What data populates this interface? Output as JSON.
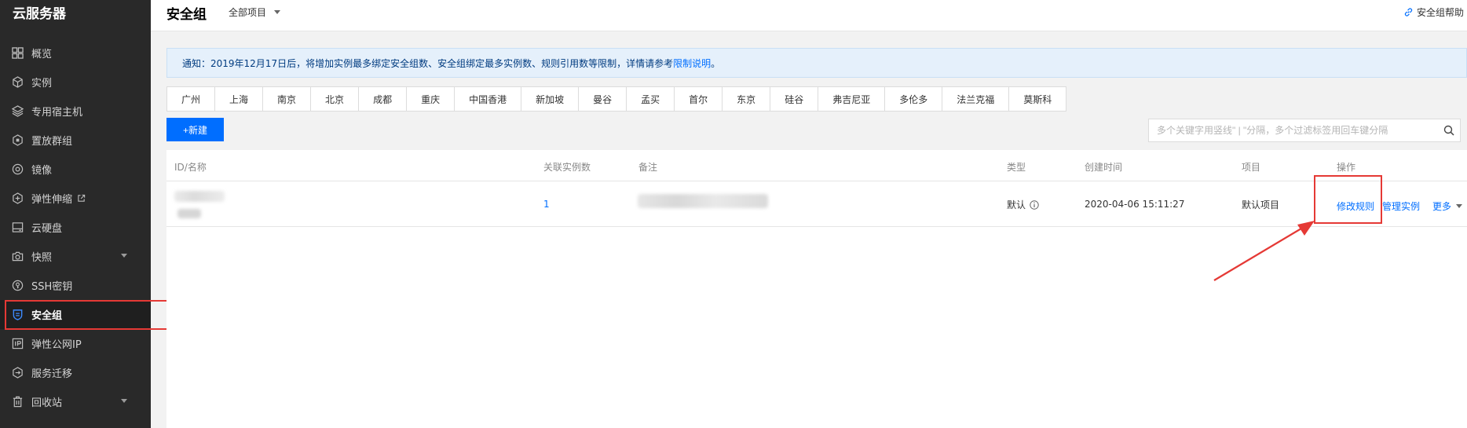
{
  "sidebar": {
    "title": "云服务器",
    "items": [
      {
        "label": "概览",
        "icon": "grid-icon"
      },
      {
        "label": "实例",
        "icon": "cube-icon"
      },
      {
        "label": "专用宿主机",
        "icon": "layers-icon"
      },
      {
        "label": "置放群组",
        "icon": "placement-icon"
      },
      {
        "label": "镜像",
        "icon": "disc-icon"
      },
      {
        "label": "弹性伸缩",
        "icon": "scaling-icon"
      },
      {
        "label": "云硬盘",
        "icon": "disk-icon"
      },
      {
        "label": "快照",
        "icon": "camera-icon"
      },
      {
        "label": "SSH密钥",
        "icon": "key-icon"
      },
      {
        "label": "安全组",
        "icon": "shield-icon"
      },
      {
        "label": "弹性公网IP",
        "icon": "ip-icon"
      },
      {
        "label": "服务迁移",
        "icon": "migrate-icon"
      },
      {
        "label": "回收站",
        "icon": "trash-icon"
      }
    ]
  },
  "header": {
    "title": "安全组",
    "project_select": "全部项目",
    "help": "安全组帮助"
  },
  "notice": {
    "text": "通知：2019年12月17日后，将增加实例最多绑定安全组数、安全组绑定最多实例数、规则引用数等限制，详情请参考",
    "link": "限制说明",
    "end": "。"
  },
  "regions": [
    "广州",
    "上海",
    "南京",
    "北京",
    "成都",
    "重庆",
    "中国香港",
    "新加坡",
    "曼谷",
    "孟买",
    "首尔",
    "东京",
    "硅谷",
    "弗吉尼亚",
    "多伦多",
    "法兰克福",
    "莫斯科"
  ],
  "toolbar": {
    "new_label": "+新建",
    "search_placeholder": "多个关键字用竖线\" | \"分隔，多个过滤标签用回车键分隔"
  },
  "table": {
    "headers": {
      "id_name": "ID/名称",
      "instances": "关联实例数",
      "remark": "备注",
      "type": "类型",
      "created": "创建时间",
      "project": "项目",
      "ops": "操作"
    },
    "row": {
      "instances": "1",
      "type": "默认",
      "created": "2020-04-06 15:11:27",
      "project": "默认项目",
      "op_modify": "修改规则",
      "op_manage": "管理实例",
      "op_more": "更多"
    }
  },
  "colors": {
    "accent": "#006eff",
    "highlight": "#e53935",
    "sidebar_bg": "#292929"
  }
}
